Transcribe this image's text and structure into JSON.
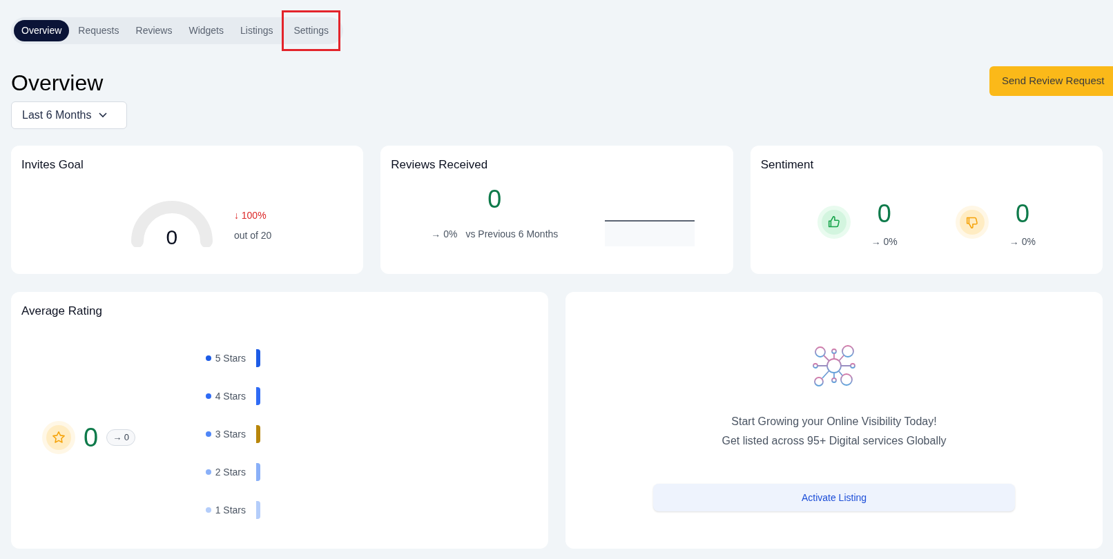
{
  "tabs": [
    {
      "label": "Overview",
      "selected": true,
      "highlighted": false
    },
    {
      "label": "Requests",
      "selected": false,
      "highlighted": false
    },
    {
      "label": "Reviews",
      "selected": false,
      "highlighted": false
    },
    {
      "label": "Widgets",
      "selected": false,
      "highlighted": false
    },
    {
      "label": "Listings",
      "selected": false,
      "highlighted": false
    },
    {
      "label": "Settings",
      "selected": false,
      "highlighted": true
    }
  ],
  "page_title": "Overview",
  "send_button": "Send Review Request",
  "period_dropdown": "Last 6 Months",
  "invites_goal": {
    "title": "Invites Goal",
    "value": "0",
    "change": "↓ 100%",
    "target": "out of 20"
  },
  "reviews_received": {
    "title": "Reviews Received",
    "value": "0",
    "change": "→ 0%",
    "comparison": "vs Previous 6 Months"
  },
  "sentiment": {
    "title": "Sentiment",
    "items": [
      {
        "kind": "positive",
        "value": "0",
        "change": "→ 0%"
      },
      {
        "kind": "negative",
        "value": "0",
        "change": "→ 0%"
      }
    ]
  },
  "average_rating": {
    "title": "Average Rating",
    "value": "0",
    "change": "→ 0",
    "rows": [
      {
        "label": "5 Stars",
        "color": "#1d5ce6",
        "bar": {
          "color": "#1d5ce6"
        }
      },
      {
        "label": "4 Stars",
        "color": "#2f6bf5",
        "bar": {
          "color": "#2f6bf5"
        }
      },
      {
        "label": "3 Stars",
        "color": "#4f86f7",
        "bar": {
          "color": "#b8860b"
        }
      },
      {
        "label": "2 Stars",
        "color": "#8ab0f8",
        "bar": {
          "color": "#8ab0f8"
        }
      },
      {
        "label": "1 Stars",
        "color": "#b4cdfa",
        "bar": {
          "color": "#b4cdfa"
        }
      }
    ]
  },
  "listing_promo": {
    "lines": [
      "Start Growing your Online Visibility Today!",
      "Get listed across 95+ Digital services Globally"
    ],
    "button": "Activate Listing"
  }
}
